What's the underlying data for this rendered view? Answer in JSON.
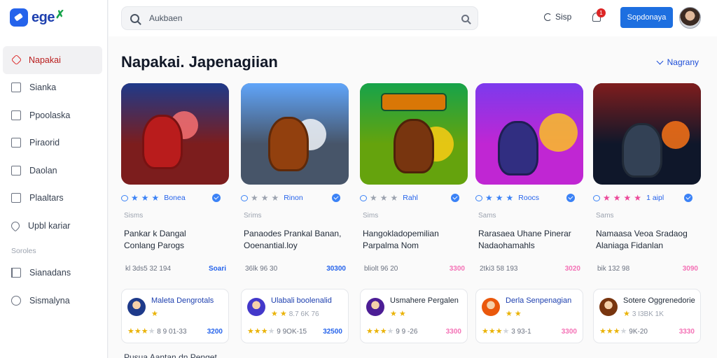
{
  "app": {
    "logo_text": "ege",
    "logo_mark": "✗"
  },
  "sidebar": {
    "items": [
      {
        "label": "Napakai",
        "icon": "diamond-icon",
        "active": true
      },
      {
        "label": "Sianka",
        "icon": "square-icon"
      },
      {
        "label": "Ppoolaska",
        "icon": "square-icon"
      },
      {
        "label": "Piraorid",
        "icon": "square-icon"
      },
      {
        "label": "Daolan",
        "icon": "square-icon"
      },
      {
        "label": "Plaaltars",
        "icon": "square-icon"
      },
      {
        "label": "Upbl kariar",
        "icon": "pin-icon"
      }
    ],
    "section_label": "Soroles",
    "section_items": [
      {
        "label": "Sianadans",
        "icon": "flag-icon"
      },
      {
        "label": "Sismalyna",
        "icon": "clock-icon"
      }
    ]
  },
  "topbar": {
    "search_placeholder": "Aukbaen",
    "sync_label": "Sisp",
    "notification_count": "1",
    "primary_button": "Sopdonaya"
  },
  "main": {
    "title": "Napakai. Japenagiian",
    "sort_label": "Nagrany",
    "games": [
      {
        "rating_label": "Bonea",
        "stars_on": 3,
        "stars_total": 3,
        "star_style": "on",
        "category": "Sisms",
        "title_line1": "Pankar k Dangal",
        "title_line2": "Conlang Parogs",
        "meta": "kl 3ds5 32 194",
        "price": "Soari",
        "price_style": "blue",
        "theme": {
          "sky": "#1e3a8a",
          "ground": "#7c1d1d",
          "sun": "#f87171",
          "hero": "#b91c1c"
        }
      },
      {
        "rating_label": "Rinon",
        "stars_on": 0,
        "stars_total": 3,
        "star_style": "off",
        "category": "Srims",
        "title_line1": "Panaodes Prankal Banan,",
        "title_line2": "Ooenantial.loy",
        "meta": "36lk 96 30",
        "price": "30300",
        "price_style": "blue",
        "theme": {
          "sky": "#60a5fa",
          "ground": "#475569",
          "sun": "#f1f5f9",
          "hero": "#92400e"
        }
      },
      {
        "rating_label": "Rahl",
        "stars_on": 0,
        "stars_total": 3,
        "star_style": "off",
        "category": "Sims",
        "title_line1": "Hangokladopemilian",
        "title_line2": "Parpalma Nom",
        "meta": "bliolt 96 20",
        "price": "3300",
        "price_style": "pink",
        "theme": {
          "sky": "#16a34a",
          "ground": "#65a30d",
          "sun": "#facc15",
          "hero": "#78350f"
        }
      },
      {
        "rating_label": "Roocs",
        "stars_on": 3,
        "stars_total": 3,
        "star_style": "on",
        "category": "Sams",
        "title_line1": "Rarasaea Uhane Pinerar",
        "title_line2": "Nadaohamahls",
        "meta": "2tki3 58 193",
        "price": "3020",
        "price_style": "pink",
        "theme": {
          "sky": "#7c3aed",
          "ground": "#c026d3",
          "sun": "#fbbf24",
          "hero": "#312e81"
        }
      },
      {
        "rating_label": "1 aipl",
        "stars_on": 4,
        "stars_total": 4,
        "star_style": "pink",
        "category": "Sams",
        "title_line1": "Namaasa Veoa Sradaog",
        "title_line2": "Alaniaga Fidanlan",
        "meta": "bik 132 98",
        "price": "3090",
        "price_style": "pink",
        "theme": {
          "sky": "#7f1d1d",
          "ground": "#0f172a",
          "sun": "#f97316",
          "hero": "#334155"
        }
      }
    ],
    "cards": [
      {
        "title": "Maleta Dengrotals",
        "title_style": "blue",
        "sub": "",
        "sub_stars": 1,
        "foot_meta": "8 9 01-33",
        "foot_stars": 3,
        "price": "3200",
        "price_style": "blue",
        "avatar_color": "#1e3a8a"
      },
      {
        "title": "Ulabali boolenalid",
        "title_style": "blue",
        "sub": "8.7 6K 76",
        "sub_stars": 2,
        "foot_meta": "9 9OK-15",
        "foot_stars": 3,
        "price": "32500",
        "price_style": "blue",
        "avatar_color": "#4338ca"
      },
      {
        "title": "Usmahere Pergalen",
        "title_style": "dark",
        "sub": "",
        "sub_stars": 2,
        "foot_meta": "9 9 -26",
        "foot_stars": 3,
        "price": "3300",
        "price_style": "pink",
        "avatar_color": "#4c1d95"
      },
      {
        "title": "Derla Senpenagian",
        "title_style": "blue",
        "sub": "",
        "sub_stars": 2,
        "foot_meta": "3 93-1",
        "foot_stars": 3,
        "price": "3300",
        "price_style": "pink",
        "avatar_color": "#ea580c"
      },
      {
        "title": "Sotere Oggrenedorie",
        "title_style": "dark",
        "sub": "3 I3BK 1K",
        "sub_stars": 1,
        "foot_meta": "9K-20",
        "foot_stars": 3,
        "price": "3330",
        "price_style": "pink",
        "avatar_color": "#78350f"
      }
    ],
    "cut_text": "Pusua Aantan dn Penget"
  }
}
